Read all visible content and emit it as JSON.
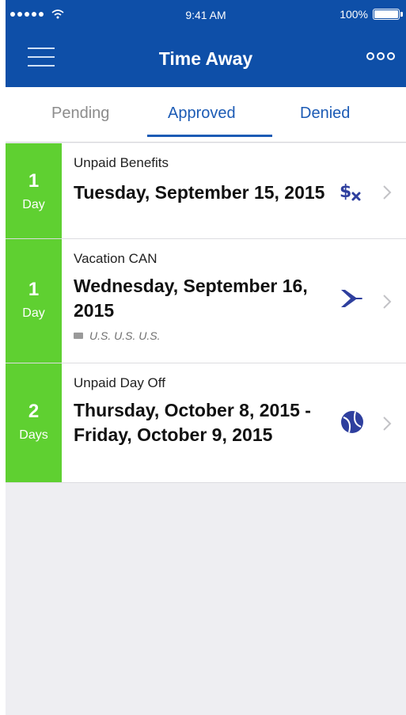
{
  "status_bar": {
    "time": "9:41 AM",
    "battery": "100%"
  },
  "nav": {
    "title": "Time Away",
    "menu_icon": "hamburger-icon",
    "more_icon": "more-icon"
  },
  "tabs": [
    {
      "label": "Pending",
      "selected": false
    },
    {
      "label": "Approved",
      "selected": true
    },
    {
      "label": "Denied",
      "selected": false
    }
  ],
  "requests": [
    {
      "duration": "1",
      "unit": "Day",
      "type": "Unpaid Benefits",
      "date": "Tuesday, September 15, 2015",
      "icon": "money-icon"
    },
    {
      "duration": "1",
      "unit": "Day",
      "type": "Vacation CAN",
      "date": "Wednesday, September 16, 2015",
      "location": "U.S. U.S. U.S.",
      "icon": "airplane-icon"
    },
    {
      "duration": "2",
      "unit": "Days",
      "type": "Unpaid Day Off",
      "date": "Thursday, October 8, 2015 - Friday, October 9, 2015",
      "icon": "ball-icon"
    }
  ],
  "colors": {
    "header": "#0e4fa8",
    "accent": "#1c5bb5",
    "duration": "#5fd031",
    "icon": "#2e3f9e"
  }
}
